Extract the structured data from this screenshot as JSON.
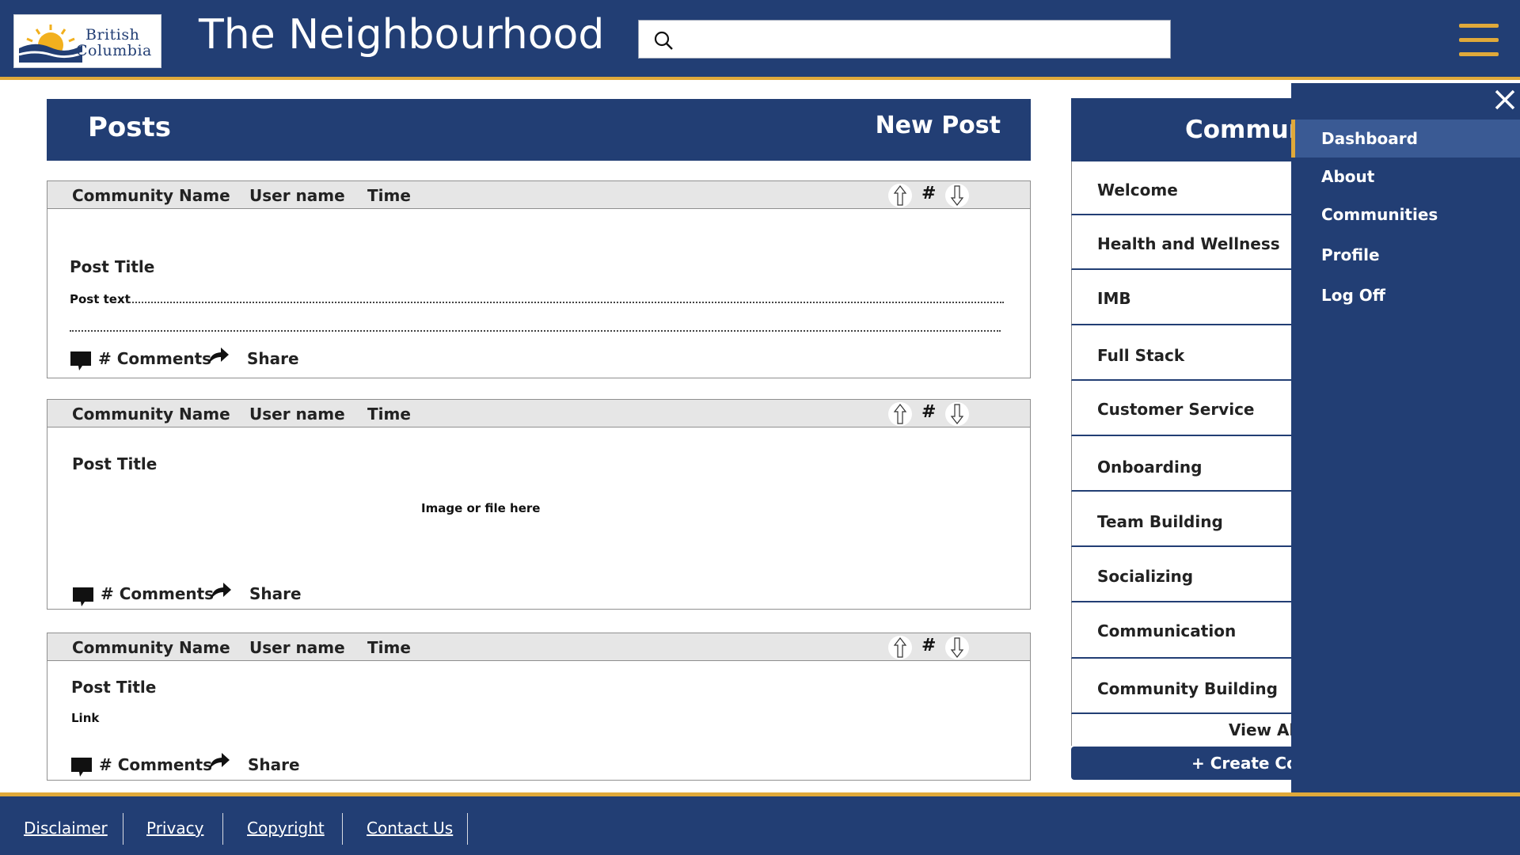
{
  "header": {
    "logo_line1": "British",
    "logo_line2": "Columbia",
    "title": "The Neighbourhood",
    "search_placeholder": "",
    "menu_icon": "hamburger-icon"
  },
  "posts": {
    "heading": "Posts",
    "new_post_label": "New Post",
    "items": [
      {
        "community": "Community Name",
        "user": "User name",
        "time": "Time",
        "votes": "#",
        "title": "Post Title",
        "body": "Post text",
        "comments_label": "# Comments",
        "share_label": "Share"
      },
      {
        "community": "Community Name",
        "user": "User name",
        "time": "Time",
        "votes": "#",
        "title": "Post Title",
        "body": "Image or file here",
        "comments_label": "# Comments",
        "share_label": "Share"
      },
      {
        "community": "Community Name",
        "user": "User name",
        "time": "Time",
        "votes": "#",
        "title": "Post Title",
        "body": "Link",
        "comments_label": "# Comments",
        "share_label": "Share"
      }
    ]
  },
  "communities": {
    "heading": "Communities",
    "items": [
      "Welcome",
      "Health and Wellness",
      "IMB",
      "Full Stack",
      "Customer Service",
      "Onboarding",
      "Team Building",
      "Socializing",
      "Communication",
      "Community Building"
    ],
    "view_all_label": "View All",
    "create_label": "+ Create Community"
  },
  "sidenav": {
    "items": [
      "Dashboard",
      "About",
      "Communities",
      "Profile",
      "Log Off"
    ],
    "active": "Dashboard"
  },
  "footer": {
    "links": [
      "Disclaimer",
      "Privacy",
      "Copyright",
      "Contact Us"
    ]
  },
  "colors": {
    "primary": "#223e74",
    "accent": "#e0a93a",
    "card_header": "#e6e6e6"
  }
}
